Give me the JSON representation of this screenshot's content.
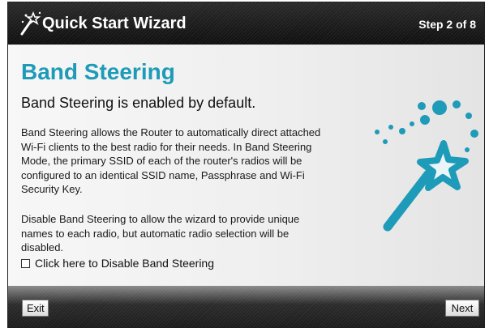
{
  "header": {
    "title": "Quick Start Wizard",
    "step": "Step 2 of 8"
  },
  "main": {
    "title": "Band Steering",
    "subtitle": "Band Steering is enabled by default.",
    "paragraph1": "Band Steering allows the Router to automatically direct attached Wi-Fi clients to the best radio for their needs. In Band Steering Mode, the primary SSID of each of the router's radios will be configured to an identical SSID name, Passphrase and Wi-Fi Security Key.",
    "paragraph2": "Disable Band Steering to allow the wizard to provide unique names to each radio, but automatic radio selection will be disabled.",
    "checkbox_label": "Click here to Disable Band Steering",
    "checkbox_checked": false
  },
  "footer": {
    "exit_label": "Exit",
    "next_label": "Next"
  },
  "colors": {
    "accent": "#1e9bb8",
    "header_bg": "#1a1a1a"
  },
  "icons": {
    "header_icon": "magic-wand-icon",
    "illustration": "magic-wand-star-illustration"
  }
}
